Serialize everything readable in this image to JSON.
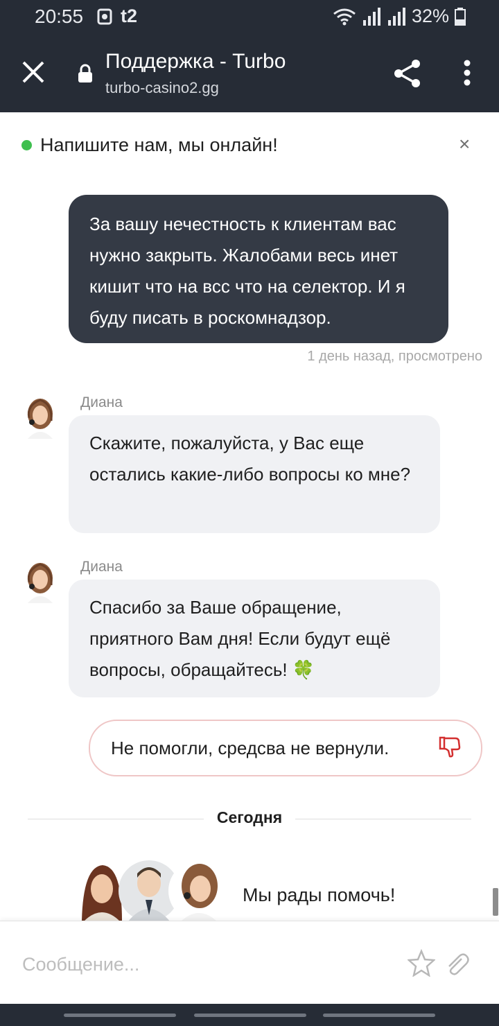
{
  "status_bar": {
    "time": "20:55",
    "carrier": "t2",
    "battery": "32%"
  },
  "browser": {
    "title": "Поддержка - Turbo",
    "url": "turbo-casino2.gg"
  },
  "banner": {
    "text": "Напишите нам, мы онлайн!",
    "close": "×"
  },
  "messages": {
    "user_1": "За вашу нечестность к клиентам вас нужно закрыть. Жалобами весь инет кишит что на всс что на селектор. И я буду писать в роскомнадзор.",
    "user_1_meta": "1 день назад, просмотрено",
    "agent_1_name": "Диана",
    "agent_1_text": "Скажите, пожалуйста, у Вас еще остались какие-либо вопросы ко мне?",
    "agent_2_name": "Диана",
    "agent_2_text": "Спасибо за Ваше обращение, приятного Вам дня! Если будут ещё вопросы, обращайтесь! 🍀",
    "feedback_text": "Не помогли, средсва не вернули."
  },
  "separator": {
    "label": "Сегодня"
  },
  "team": {
    "text": "Мы рады помочь!"
  },
  "composer": {
    "placeholder": "Сообщение..."
  },
  "colors": {
    "header": "#262c36",
    "user_bubble": "#343a45",
    "agent_bubble": "#f0f1f4",
    "online": "#3fbf4f",
    "dislike": "#d32f2f"
  },
  "icons": [
    "close-icon",
    "lock-icon",
    "share-icon",
    "more-vert-icon",
    "thumbs-down-icon",
    "star-icon",
    "paperclip-icon",
    "clover-emoji"
  ]
}
